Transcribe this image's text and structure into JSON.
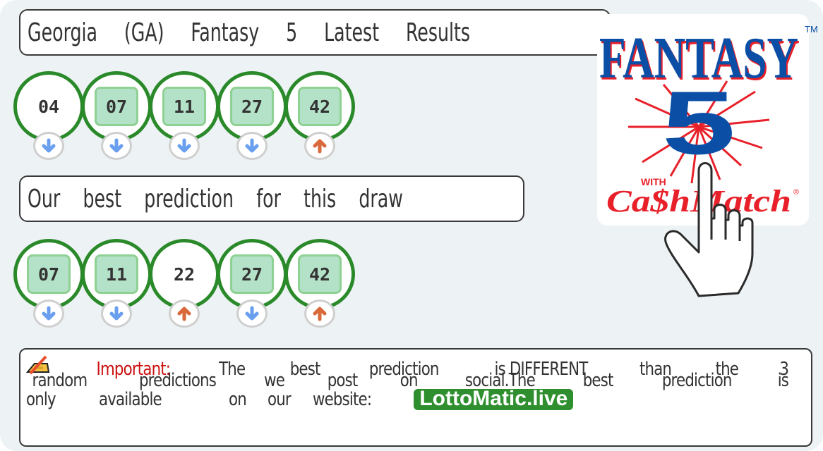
{
  "latest": {
    "title_words": [
      "Georgia",
      "(GA)",
      "Fantasy",
      "5",
      "Latest",
      "Results"
    ],
    "balls": [
      {
        "number": "04",
        "matched": false,
        "trend": "down"
      },
      {
        "number": "07",
        "matched": true,
        "trend": "down"
      },
      {
        "number": "11",
        "matched": true,
        "trend": "down"
      },
      {
        "number": "27",
        "matched": true,
        "trend": "down"
      },
      {
        "number": "42",
        "matched": true,
        "trend": "up"
      }
    ]
  },
  "prediction": {
    "title_words": [
      "Our",
      "best",
      "prediction",
      "for",
      "this",
      "draw"
    ],
    "balls": [
      {
        "number": "07",
        "matched": true,
        "trend": "down"
      },
      {
        "number": "11",
        "matched": true,
        "trend": "down"
      },
      {
        "number": "22",
        "matched": false,
        "trend": "up"
      },
      {
        "number": "27",
        "matched": true,
        "trend": "down"
      },
      {
        "number": "42",
        "matched": true,
        "trend": "up"
      }
    ]
  },
  "logo": {
    "title": "FANTASY",
    "number": "5",
    "with": "WITH",
    "subtitle": "Ca$hMatch",
    "tm": "TM",
    "reg": "®",
    "icon": "hand-pointer-icon"
  },
  "notice": {
    "icon": "writing-hand-icon",
    "important_label": "Important:",
    "line1": [
      "The",
      "best",
      "prediction",
      "is DIFFERENT",
      "than",
      "the",
      "3"
    ],
    "line2": [
      "random",
      "predictions",
      "we",
      "post",
      "on",
      "social.The",
      "best",
      "prediction",
      "is"
    ],
    "line3": [
      "only",
      "available",
      "on",
      "our",
      "website:"
    ],
    "link_text": "LottoMatic.live"
  },
  "colors": {
    "ball_border": "#2a8a2a",
    "match_fill": "#b4e2c8",
    "trend_down": "#6a9ff0",
    "trend_up": "#d9683a",
    "important": "#cc1111",
    "link_bg": "#2f8f2f"
  }
}
